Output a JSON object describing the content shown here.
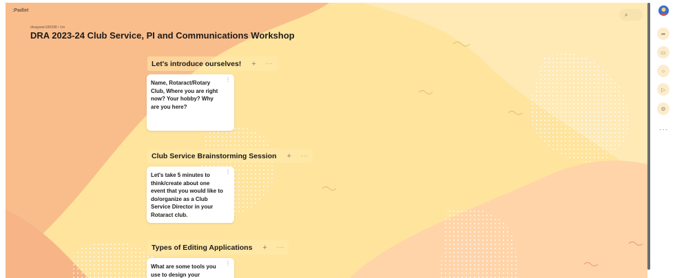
{
  "brand": ":Padlet",
  "byline": "divagaran180398 • 1m",
  "title": "DRA 2023-24 Club Service, PI and Communications Workshop",
  "search_icon": "search-icon",
  "sections": [
    {
      "title": "Let's introduce ourselves!",
      "plus": "+",
      "more": "···",
      "card": {
        "text": "Name, Rotaract/Rotary Club, Where you are right now? Your hobby? Why are you here?",
        "menu": "⋮"
      }
    },
    {
      "title": "Club Service Brainstorming Session",
      "plus": "+",
      "more": "···",
      "card": {
        "text": "Let's take 5 minutes to think/create about one event that you would like to do/organize as a Club Service Director in your Rotaract club.",
        "menu": "⋮"
      }
    },
    {
      "title": "Types of Editing Applications",
      "plus": "+",
      "more": "···",
      "card": {
        "text": "What are some tools you use to design your publicity",
        "menu": "⋮"
      }
    }
  ],
  "rail": {
    "buttons": [
      "avatar",
      "share-icon",
      "remake-icon",
      "bell-icon",
      "slideshow-icon",
      "settings-icon"
    ],
    "more": "···"
  },
  "colors": {
    "background_yellow": "#ffe49e",
    "blob_peach": "#f9bd8c",
    "blob_light": "#ffeab6",
    "card_bg": "#ffffff",
    "text": "#1c1b1a"
  }
}
